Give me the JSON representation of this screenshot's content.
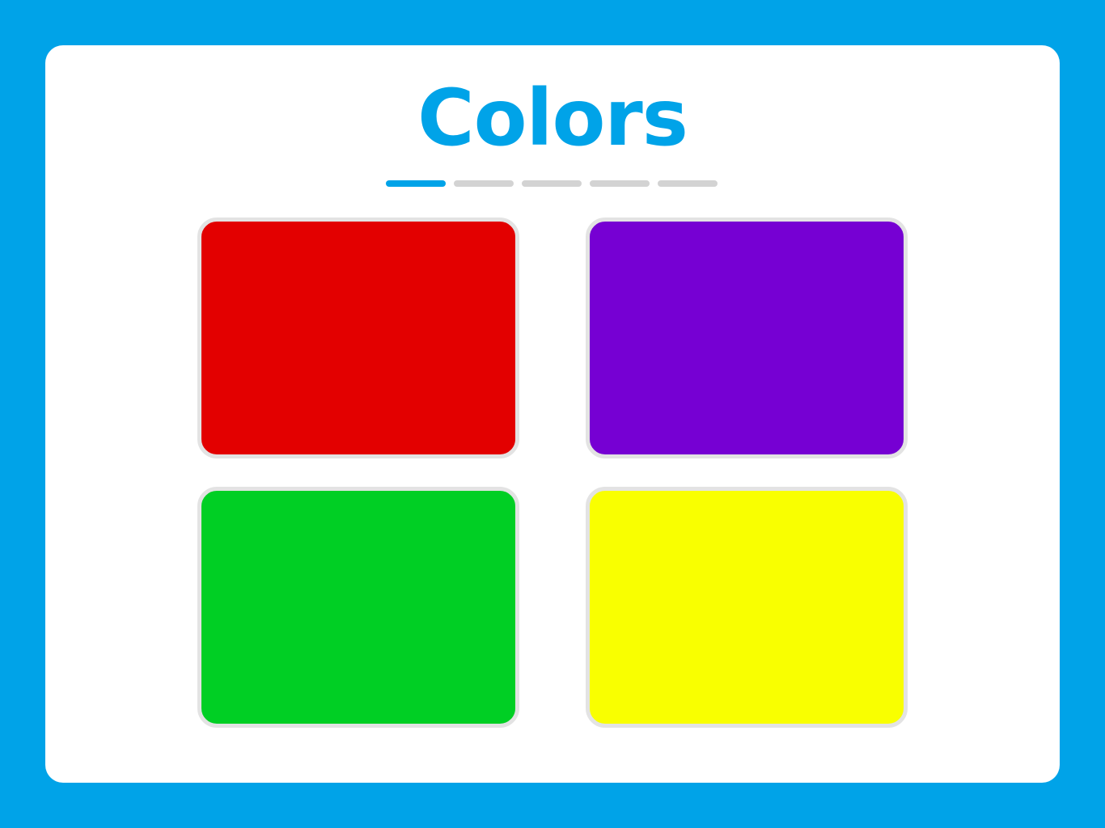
{
  "title": "Colors",
  "colors": {
    "background": "#00a3e8",
    "card": "#ffffff",
    "accent": "#00a3e8",
    "progress_inactive": "#d3d3d3",
    "swatch_border": "#e3e3e3"
  },
  "progress": {
    "total_steps": 5,
    "current_step": 1
  },
  "swatches": [
    {
      "name": "red",
      "color": "#e30000"
    },
    {
      "name": "purple",
      "color": "#7600d3"
    },
    {
      "name": "green",
      "color": "#00cf24"
    },
    {
      "name": "yellow",
      "color": "#f9ff00"
    }
  ]
}
